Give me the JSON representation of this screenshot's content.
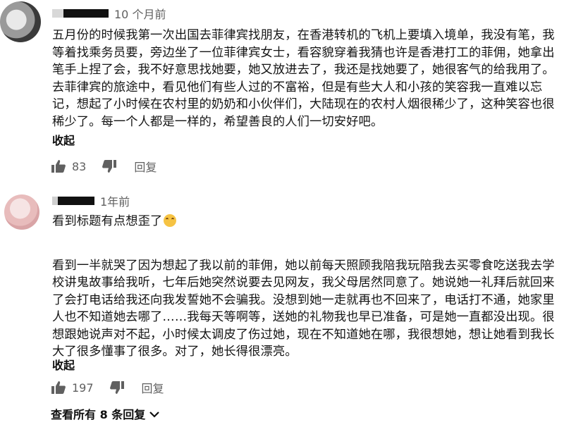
{
  "comments": [
    {
      "time": "10 个月前",
      "text": "五月份的时候我第一次出国去菲律宾找朋友，在香港转机的飞机上要填入境单，我没有笔，我等着找乘务员要，旁边坐了一位菲律宾女士，看容貌穿着我猜也许是香港打工的菲佣，她拿出笔手上捏了会，我不好意思找她要，她又放进去了，我还是找她要了，她很客气的给我用了。去菲律宾的旅途中，看见他们有些人过的不富裕，但是有些大人和小孩的笑容我一直难以忘记，想起了小时候在农村里的奶奶和小伙伴们，大陆现在的农村人烟很稀少了，这种笑容也很稀少了。每一个人都是一样的，希望善良的人们一切安好吧。",
      "collapse_label": "收起",
      "like_count": "83",
      "reply_label": "回复"
    },
    {
      "time": "1年前",
      "text_line1": "看到标题有点想歪了",
      "emoji_icon": "grinning-sweat-emoji",
      "text": "看到一半就哭了因为想起了我以前的菲佣，她以前每天照顾我陪我玩陪我去买零食吃送我去学校讲鬼故事给我听，七年后她突然说要去见网友，我父母居然同意了。她说她一礼拜后就回来了会打电话给我还向我发誓她不会骗我。没想到她一走就再也不回来了，电话打不通，她家里人也不知道她去哪了……我每天等啊等，送她的礼物我也早已准备，可是她一直都没出现。很想跟她说声对不起，小时候太调皮了伤过她，现在不知道她在哪，我很想她，想让她看到我长大了很多懂事了很多。对了，她长得很漂亮。",
      "collapse_label": "收起",
      "like_count": "197",
      "reply_label": "回复"
    }
  ],
  "view_replies_label": "查看所有 8 条回复",
  "icons": {
    "like": "thumbs-up-icon",
    "dislike": "thumbs-down-icon",
    "expand": "chevron-down-icon"
  },
  "colors": {
    "text": "#0f0f0f",
    "secondary": "#606060",
    "background": "#ffffff"
  }
}
